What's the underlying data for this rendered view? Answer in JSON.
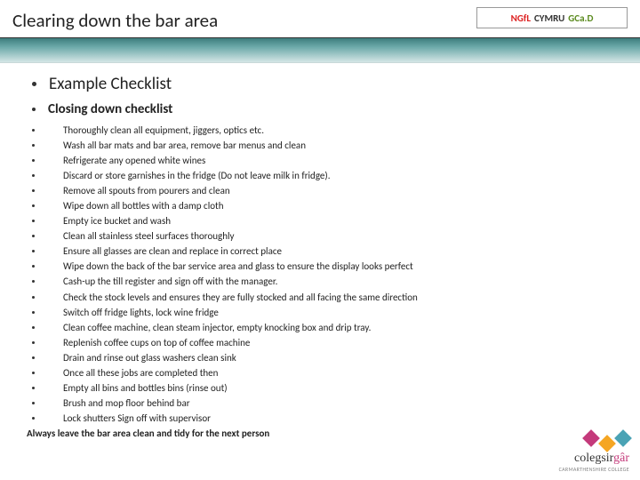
{
  "title": "Clearing down the bar area",
  "topLogo": {
    "ngfl": "NGfL",
    "cymru": "CYMRU",
    "gcad": "GCa.D"
  },
  "heading1": "Example Checklist",
  "heading2": "Closing down checklist",
  "items": [
    "Thoroughly clean all equipment, jiggers, optics etc.",
    "Wash all bar mats and bar area, remove bar menus and clean",
    "Refrigerate any opened white wines",
    "Discard or store garnishes in the fridge (Do not leave milk in fridge).",
    "Remove all spouts from pourers and clean",
    "Wipe down all bottles with a damp cloth",
    "Empty ice bucket and wash",
    "Clean all stainless steel surfaces thoroughly",
    "Ensure all glasses are clean and replace in correct place",
    "Wipe down the back of the bar service area and glass to ensure the display looks perfect",
    "Cash-up the till register and sign off with the manager.",
    "Check the stock levels and ensures they are fully stocked and all facing the same direction",
    "Switch off fridge lights, lock wine fridge",
    "Clean coffee machine, clean steam injector, empty knocking box and drip tray.",
    "Replenish coffee cups on top of coffee machine",
    "Drain and rinse out glass washers clean sink",
    "Once all these jobs are completed then",
    "Empty all bins and bottles bins (rinse out)",
    "Brush and mop floor behind bar",
    "Lock shutters Sign off with supervisor"
  ],
  "finalLine": "Always leave the bar area clean and tidy for the next person",
  "coleg": {
    "name1": "colegsir",
    "name2": "gâr",
    "sub": "CARMARTHENSHIRE COLLEGE"
  }
}
